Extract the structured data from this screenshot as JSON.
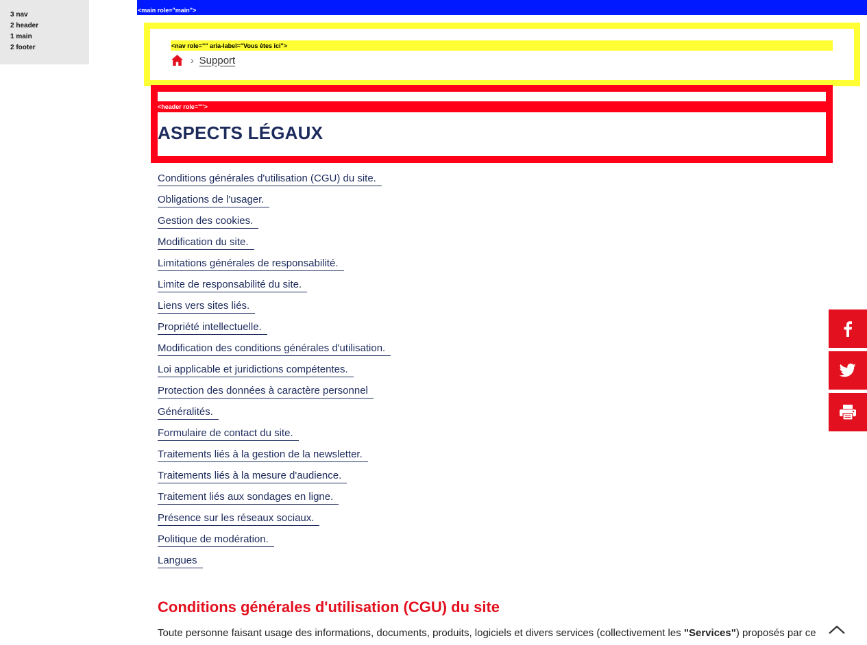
{
  "landmarks": [
    "3 nav",
    "2 header",
    "1 main",
    "2 footer"
  ],
  "main_tag": "<main role=\"main\">",
  "breadcrumb": {
    "tag": "<nav role=\"\" aria-label=\"Vous êtes ici\">",
    "home_icon": "home-icon",
    "separator": "›",
    "current": "Support"
  },
  "header": {
    "tag": "<header role=\"\">",
    "title": "ASPECTS LÉGAUX"
  },
  "toc": [
    "Conditions générales d'utilisation (CGU) du site.",
    "Obligations de l'usager.",
    "Gestion des cookies.",
    "Modification du site.",
    "Limitations générales de responsabilité.",
    "Limite de responsabilité du site.",
    "Liens vers sites liés.",
    "Propriété intellectuelle.",
    "Modification des conditions générales d'utilisation.",
    "Loi applicable et juridictions compétentes.",
    "Protection des données à caractère personnel",
    "Généralités.",
    "Formulaire de contact du site.",
    "Traitements liés à la gestion de la newsletter.",
    "Traitements liés à la mesure d'audience.",
    "Traitement liés aux sondages en ligne.",
    "Présence sur les réseaux sociaux.",
    "Politique de modération.",
    "Langues"
  ],
  "section": {
    "title": "Conditions générales d'utilisation (CGU) du site",
    "body_before": "Toute personne faisant usage des informations, documents, produits, logiciels et divers services (collectivement les ",
    "body_bold": "\"Services\"",
    "body_after": ") proposés par ce"
  },
  "share": {
    "facebook_icon": "facebook-icon",
    "twitter_icon": "twitter-icon",
    "print_icon": "print-icon"
  },
  "back_to_top_icon": "chevron-up-icon",
  "colors": {
    "main_landmark": "#0019ff",
    "nav_landmark": "#ffff33",
    "header_landmark": "#ff0018",
    "title_navy": "#1d2b5c",
    "accent_red": "#e3101f"
  }
}
